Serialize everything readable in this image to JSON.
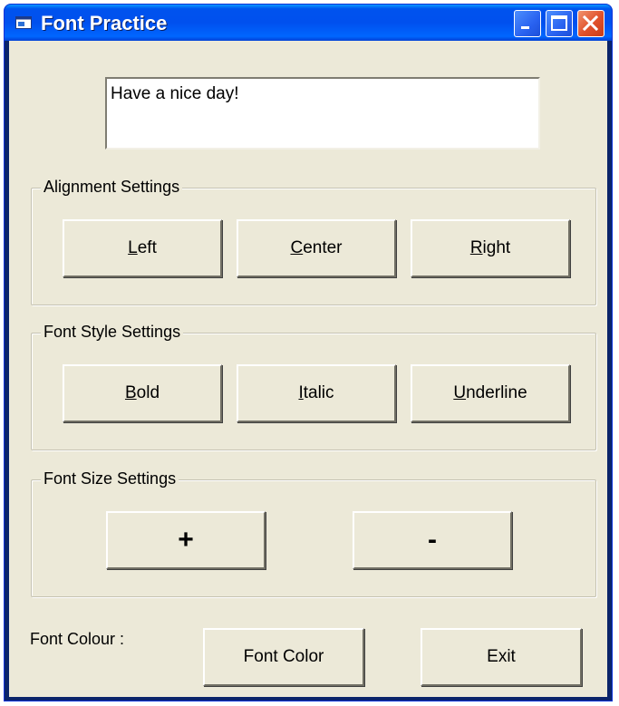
{
  "window": {
    "title": "Font Practice",
    "minimize_icon": "minimize-icon",
    "maximize_icon": "maximize-icon",
    "close_icon": "close-icon"
  },
  "textbox": {
    "value": "Have a nice day!"
  },
  "alignment": {
    "legend": "Alignment Settings",
    "left": {
      "mnemonic": "L",
      "rest": "eft"
    },
    "center": {
      "mnemonic": "C",
      "rest": "enter"
    },
    "right": {
      "mnemonic": "R",
      "rest": "ight"
    }
  },
  "style": {
    "legend": "Font Style Settings",
    "bold": {
      "mnemonic": "B",
      "rest": "old"
    },
    "italic": {
      "mnemonic": "I",
      "rest": "talic"
    },
    "underline": {
      "mnemonic": "U",
      "rest": "nderline"
    }
  },
  "size": {
    "legend": "Font Size Settings",
    "increase": "+",
    "decrease": "-"
  },
  "footer": {
    "colour_label": "Font Colour :",
    "font_color_button": "Font Color",
    "exit_button": "Exit"
  },
  "colors": {
    "titlebar": "#0055e5",
    "client_bg": "#ece9d8",
    "close_button": "#e0502a"
  }
}
